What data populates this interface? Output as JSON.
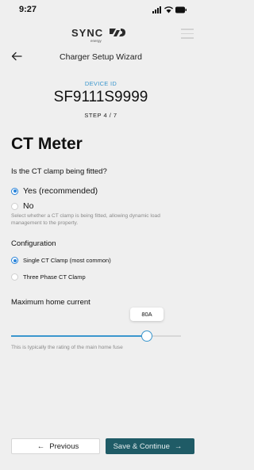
{
  "status_bar": {
    "time": "9:27"
  },
  "header": {
    "logo_text": "SYNC",
    "logo_sub": "energy",
    "title": "Charger Setup Wizard"
  },
  "device": {
    "label": "DEVICE ID",
    "id": "SF9111S9999",
    "step": "STEP 4 / 7"
  },
  "section_title": "CT Meter",
  "ct_clamp": {
    "question": "Is the CT clamp being fitted?",
    "options": [
      {
        "label": "Yes (recommended)",
        "checked": true
      },
      {
        "label": "No",
        "checked": false
      }
    ],
    "helper": "Select whether a CT clamp is being fitted, allowing dynamic load management to the property."
  },
  "configuration": {
    "label": "Configuration",
    "options": [
      {
        "label": "Single CT Clamp (most common)",
        "checked": true
      },
      {
        "label": "Three Phase CT Clamp",
        "checked": false
      }
    ]
  },
  "max_current": {
    "label": "Maximum home current",
    "value_display": "80A",
    "value_fraction": 0.8,
    "helper": "This is typically the rating of the main home fuse"
  },
  "footer": {
    "previous_label": "Previous",
    "next_label": "Save & Continue"
  },
  "colors": {
    "accent": "#3a96cd",
    "primary_button": "#1f5b66",
    "radio_selected": "#2a84d9"
  }
}
